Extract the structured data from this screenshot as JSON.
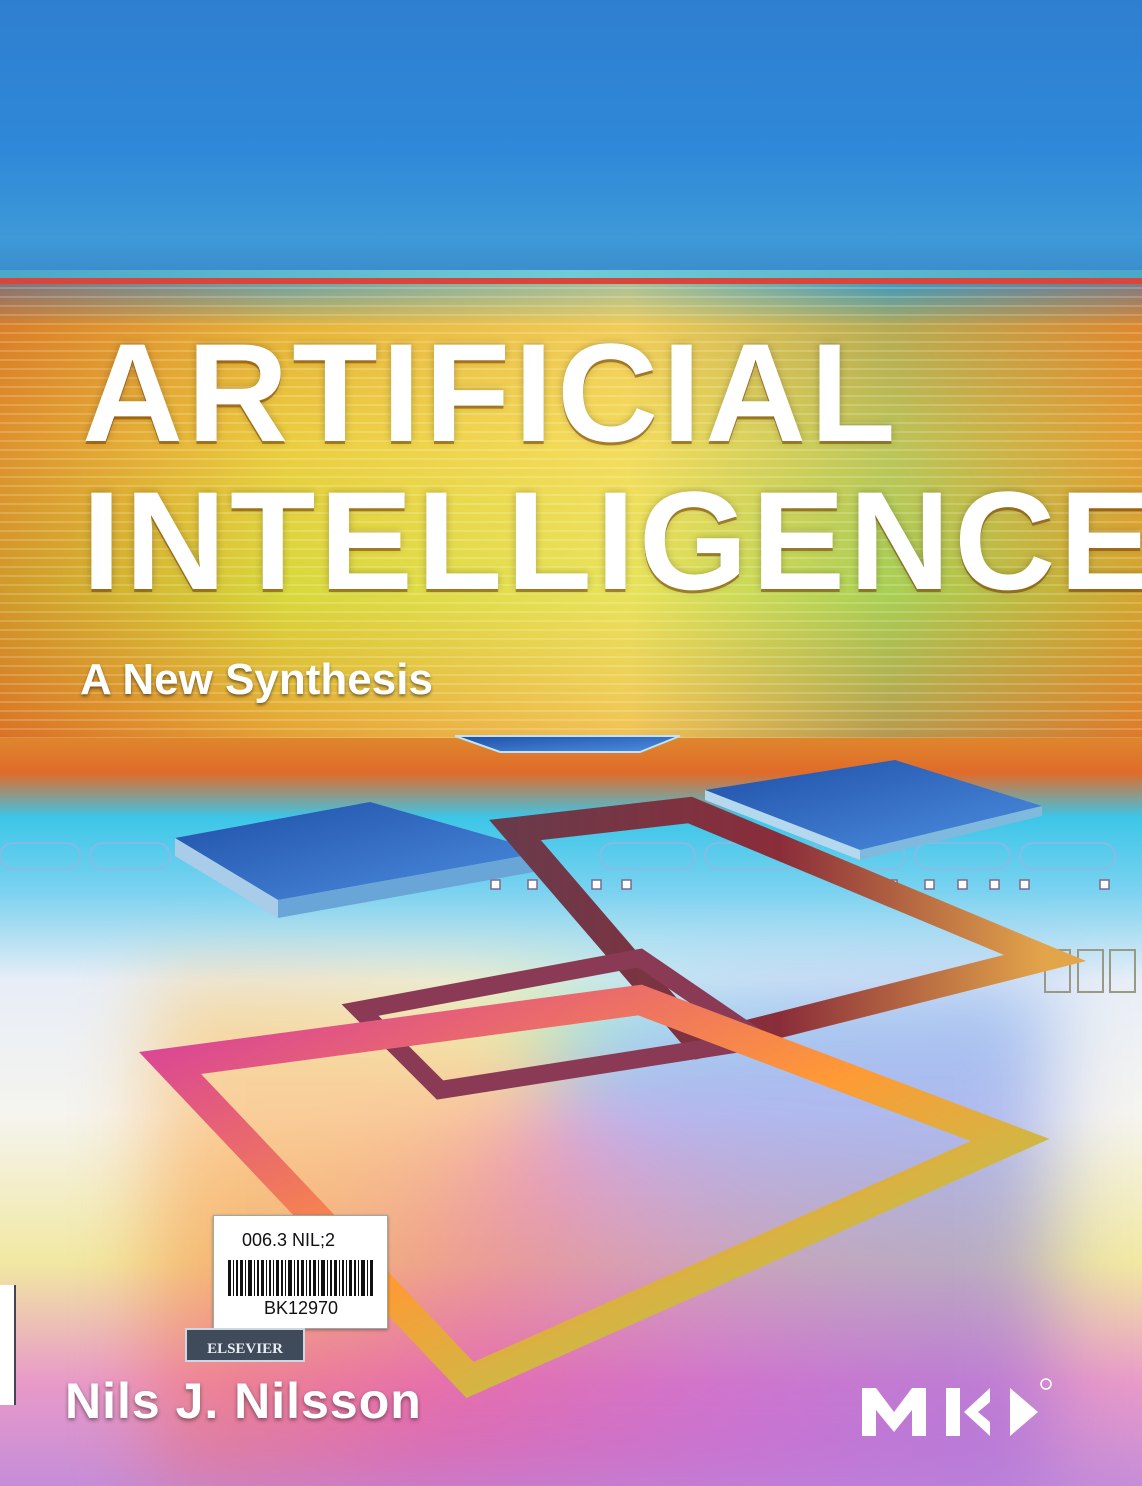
{
  "cover": {
    "title_line1": "ARTIFICIAL",
    "title_line2": "INTELLIGENCE",
    "subtitle": "A New Synthesis",
    "author": "Nils J. Nilsson",
    "publisher_logo": "MK",
    "imprint_badge": "ELSEVIER"
  },
  "library_label": {
    "call_number": "006.3 NIL;2",
    "accession_number": "BK12970"
  },
  "colors": {
    "sky": "#2f7fd0",
    "band_red": "#d8453a",
    "title_text": "#ffffff"
  }
}
